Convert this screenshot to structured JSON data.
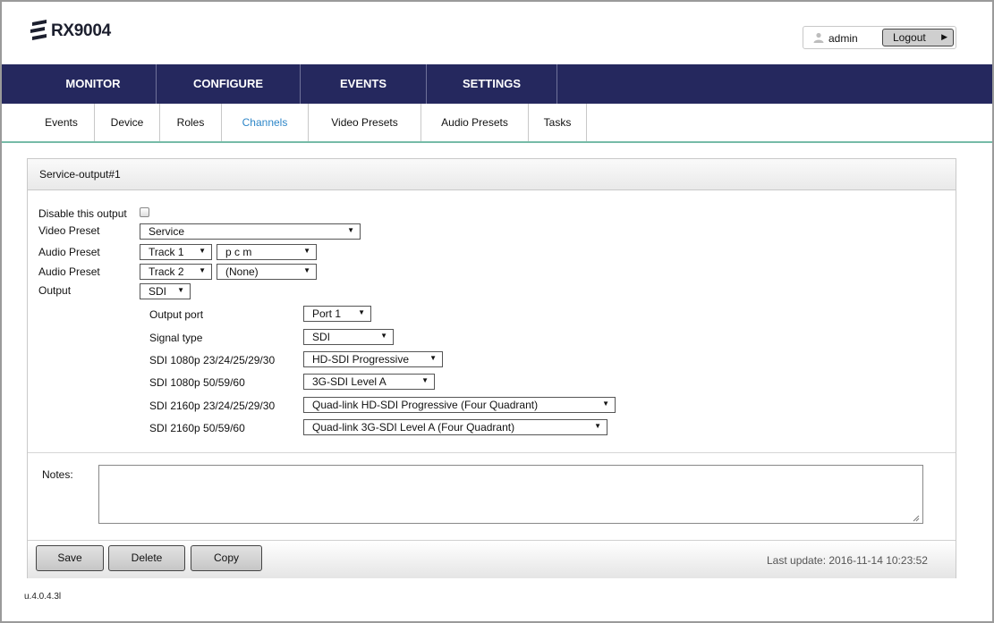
{
  "app": {
    "logo_text": "RX9004",
    "user": "admin",
    "logout_label": "Logout"
  },
  "nav": {
    "main": [
      "MONITOR",
      "CONFIGURE",
      "EVENTS",
      "SETTINGS"
    ],
    "sub": [
      "Events",
      "Device",
      "Roles",
      "Channels",
      "Video Presets",
      "Audio Presets",
      "Tasks"
    ],
    "active_sub": "Channels"
  },
  "panel": {
    "title": "Service-output#1",
    "disable_label": "Disable this output",
    "disable_checked": false,
    "video_preset": {
      "label": "Video Preset",
      "value": "Service"
    },
    "audio_preset_1": {
      "label": "Audio Preset",
      "track": "Track 1",
      "value": "p c m"
    },
    "audio_preset_2": {
      "label": "Audio Preset",
      "track": "Track 2",
      "value": "(None)"
    },
    "output": {
      "label": "Output",
      "value": "SDI"
    },
    "output_port": {
      "label": "Output port",
      "value": "Port 1"
    },
    "signal_type": {
      "label": "Signal type",
      "value": "SDI"
    },
    "sdi_1080p_low": {
      "label": "SDI 1080p 23/24/25/29/30",
      "value": "HD-SDI Progressive"
    },
    "sdi_1080p_high": {
      "label": "SDI 1080p 50/59/60",
      "value": "3G-SDI Level A"
    },
    "sdi_2160p_low": {
      "label": "SDI 2160p 23/24/25/29/30",
      "value": "Quad-link HD-SDI Progressive (Four Quadrant)"
    },
    "sdi_2160p_high": {
      "label": "SDI 2160p 50/59/60",
      "value": "Quad-link 3G-SDI Level A (Four Quadrant)"
    },
    "notes_label": "Notes:",
    "notes_value": ""
  },
  "footer": {
    "save": "Save",
    "delete": "Delete",
    "copy": "Copy",
    "last_update": "Last update: 2016-11-14 10:23:52"
  },
  "version": "u.4.0.4.3l"
}
